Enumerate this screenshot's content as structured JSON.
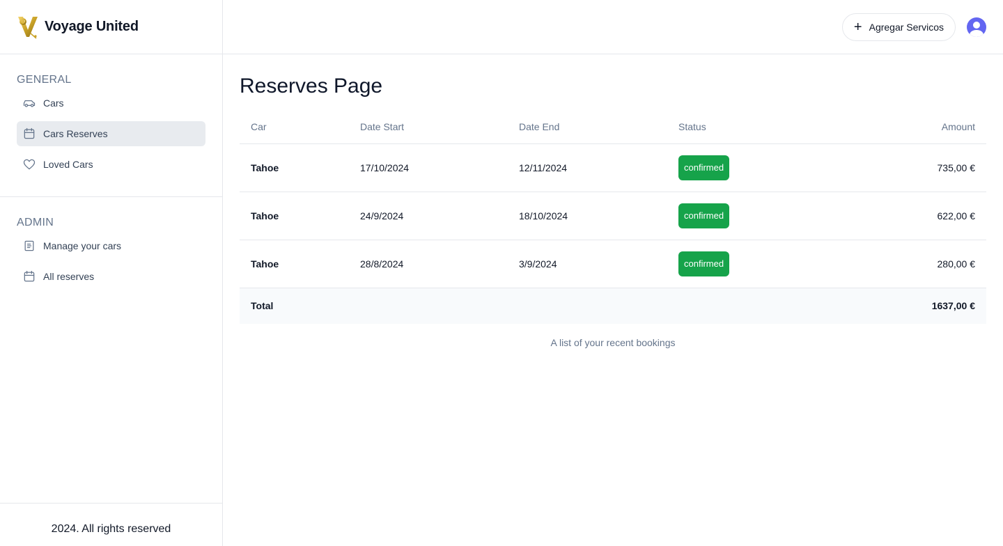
{
  "brand": {
    "name": "Voyage United",
    "logo_icon": "golden-v-pin-logo"
  },
  "sidebar": {
    "general_heading": "GENERAL",
    "general_items": [
      {
        "label": "Cars",
        "icon": "car-icon",
        "active": false
      },
      {
        "label": "Cars Reserves",
        "icon": "calendar-icon",
        "active": true
      },
      {
        "label": "Loved Cars",
        "icon": "heart-icon",
        "active": false
      }
    ],
    "admin_heading": "ADMIN",
    "admin_items": [
      {
        "label": "Manage your cars",
        "icon": "document-icon"
      },
      {
        "label": "All reserves",
        "icon": "calendar-icon"
      }
    ],
    "footer": "2024. All rights reserved"
  },
  "topbar": {
    "add_button_label": "Agregar Servicos",
    "add_button_icon": "plus-icon",
    "avatar_icon": "user-avatar-icon"
  },
  "main": {
    "title": "Reserves Page",
    "table": {
      "headers": {
        "car": "Car",
        "start": "Date Start",
        "end": "Date End",
        "status": "Status",
        "amount": "Amount"
      },
      "rows": [
        {
          "car": "Tahoe",
          "start": "17/10/2024",
          "end": "12/11/2024",
          "status": "confirmed",
          "amount": "735,00 €"
        },
        {
          "car": "Tahoe",
          "start": "24/9/2024",
          "end": "18/10/2024",
          "status": "confirmed",
          "amount": "622,00 €"
        },
        {
          "car": "Tahoe",
          "start": "28/8/2024",
          "end": "3/9/2024",
          "status": "confirmed",
          "amount": "280,00 €"
        }
      ],
      "footer": {
        "label": "Total",
        "amount": "1637,00 €"
      },
      "caption": "A list of your recent bookings"
    }
  },
  "colors": {
    "badge_confirmed": "#16a34a",
    "active_nav_bg": "#e8ebef",
    "avatar": "#6366f1",
    "logo_gold": "#c9a227"
  }
}
